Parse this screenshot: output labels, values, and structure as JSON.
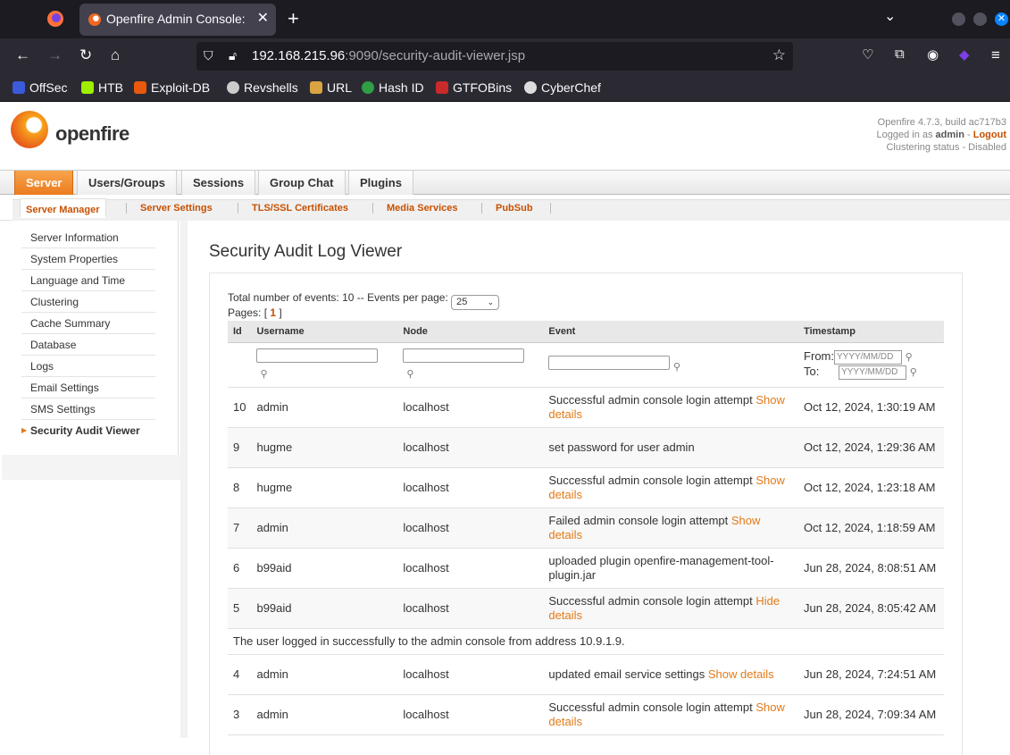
{
  "browser": {
    "tab_title": "Openfire Admin Console: Se",
    "url_host": "192.168.215.96",
    "url_path": ":9090/security-audit-viewer.jsp",
    "bookmarks": [
      "OffSec",
      "HTB",
      "Exploit-DB",
      "Revshells",
      "URL",
      "Hash ID",
      "GTFOBins",
      "CyberChef"
    ]
  },
  "header": {
    "logo_text": "openfire",
    "version": "Openfire 4.7.3, build ac717b3",
    "logged_in_prefix": "Logged in as",
    "user": "admin",
    "logout": "Logout",
    "clustering": "Clustering status - Disabled"
  },
  "main_tabs": [
    "Server",
    "Users/Groups",
    "Sessions",
    "Group Chat",
    "Plugins"
  ],
  "sub_tabs": [
    "Server Manager",
    "Server Settings",
    "TLS/SSL Certificates",
    "Media Services",
    "PubSub"
  ],
  "sidebar": [
    "Server Information",
    "System Properties",
    "Language and Time",
    "Clustering",
    "Cache Summary",
    "Database",
    "Logs",
    "Email Settings",
    "SMS Settings",
    "Security Audit Viewer"
  ],
  "page": {
    "title": "Security Audit Log Viewer",
    "total_label": "Total number of events: 10 -- Events per page:",
    "per_page": "25",
    "pages_label": "Pages: [",
    "page_num": "1",
    "pages_close": "]"
  },
  "table": {
    "headers": [
      "Id",
      "Username",
      "Node",
      "Event",
      "Timestamp"
    ],
    "from_label": "From:",
    "to_label": "To:",
    "date_placeholder": "YYYY/MM/DD",
    "rows": [
      {
        "id": "10",
        "user": "admin",
        "node": "localhost",
        "event": "Successful admin console login attempt",
        "link": "Show details",
        "ts": "Oct 12, 2024, 1:30:19 AM"
      },
      {
        "id": "9",
        "user": "hugme",
        "node": "localhost",
        "event": "set password for user admin",
        "link": "",
        "ts": "Oct 12, 2024, 1:29:36 AM"
      },
      {
        "id": "8",
        "user": "hugme",
        "node": "localhost",
        "event": "Successful admin console login attempt",
        "link": "Show details",
        "ts": "Oct 12, 2024, 1:23:18 AM"
      },
      {
        "id": "7",
        "user": "admin",
        "node": "localhost",
        "event": "Failed admin console login attempt",
        "link": "Show details",
        "ts": "Oct 12, 2024, 1:18:59 AM"
      },
      {
        "id": "6",
        "user": "b99aid",
        "node": "localhost",
        "event": "uploaded plugin openfire-management-tool-plugin.jar",
        "link": "",
        "ts": "Jun 28, 2024, 8:08:51 AM"
      },
      {
        "id": "5",
        "user": "b99aid",
        "node": "localhost",
        "event": "Successful admin console login attempt",
        "link": "Hide details",
        "ts": "Jun 28, 2024, 8:05:42 AM"
      },
      {
        "id": "4",
        "user": "admin",
        "node": "localhost",
        "event": "updated email service settings",
        "link": "Show details",
        "ts": "Jun 28, 2024, 7:24:51 AM"
      },
      {
        "id": "3",
        "user": "admin",
        "node": "localhost",
        "event": "Successful admin console login attempt",
        "link": "Show details",
        "ts": "Jun 28, 2024, 7:09:34 AM"
      }
    ],
    "detail_text": "The user logged in successfully to the admin console from address 10.9.1.9."
  }
}
